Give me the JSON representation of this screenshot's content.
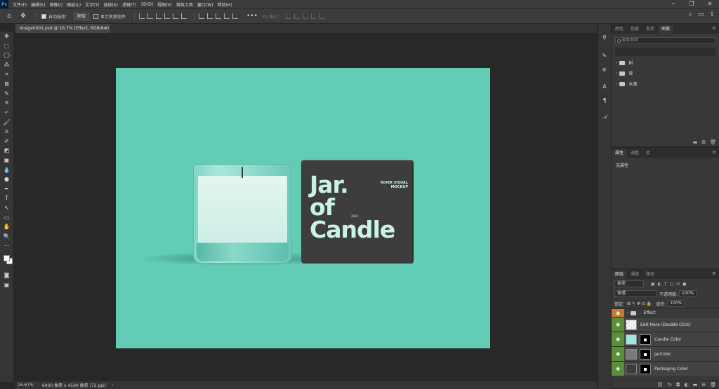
{
  "app": {
    "logo": "Ps"
  },
  "menu": [
    "文件(F)",
    "编辑(E)",
    "图像(I)",
    "图层(L)",
    "文字(Y)",
    "选择(S)",
    "滤镜(T)",
    "3D(D)",
    "视图(V)",
    "增效工具",
    "窗口(W)",
    "帮助(H)"
  ],
  "window_controls": {
    "minimize": "─",
    "restore": "❐",
    "close": "✕"
  },
  "options": {
    "home_icon": "home-icon",
    "move_icon": "move-icon",
    "auto_select_label": "自动选择：",
    "auto_select_value": "图层",
    "show_transform_label": "显示变换控件",
    "mode_3d_label": "3D 模式："
  },
  "document": {
    "tab_title": "Image0001.psd @ 16.7% (Effect, RGB/8#)",
    "close": "×"
  },
  "tools": [
    "✥",
    "⬚",
    "◯",
    "⁂",
    "⌗",
    "⊠",
    "✎",
    "✕",
    "⌐",
    "🖌",
    "♙",
    "✐",
    "◩",
    "▣",
    "💧",
    "●",
    "✒",
    "T",
    "↖",
    "▭",
    "✋",
    "🔍",
    "⋯"
  ],
  "artboard": {
    "title_line1": "Jar.",
    "title_line2": "of",
    "title_line3": "Candle",
    "subtitle_line1": "RIVER VISUAL",
    "subtitle_line2": "MOCKUP",
    "small_text": "ONT",
    "year": "2024",
    "bg_color": "#62ccb5"
  },
  "panels": {
    "top_tabs": [
      "颜色",
      "色板",
      "渐变",
      "图案"
    ],
    "search_placeholder": "搜索图案",
    "folders": [
      "树",
      "草",
      "水滴"
    ],
    "props_tabs": [
      "属性",
      "调整",
      "库"
    ],
    "props_text": "无属性",
    "layers_tabs": [
      "图层",
      "通道",
      "路径"
    ],
    "filter_label": "类型",
    "blend_mode": "穿透",
    "opacity_label": "不透明度:",
    "opacity_value": "100%",
    "lock_label": "锁定:",
    "fill_label": "填充:",
    "fill_value": "100%",
    "layers": [
      {
        "name": "Effect",
        "type": "group"
      },
      {
        "name": "Edit Here (Double Click)",
        "type": "smart"
      },
      {
        "name": "Candle Color",
        "type": "fill",
        "thumb_color": "#9be8dc"
      },
      {
        "name": "JarColor",
        "type": "fill",
        "thumb_color": "#7a7a7a"
      },
      {
        "name": "Packaging Color",
        "type": "fill",
        "thumb_color": "#3d3d3d"
      }
    ]
  },
  "status": {
    "zoom": "16.67%",
    "info": "6000 像素 x 4500 像素 (72 ppi)",
    "arrow": "›"
  }
}
